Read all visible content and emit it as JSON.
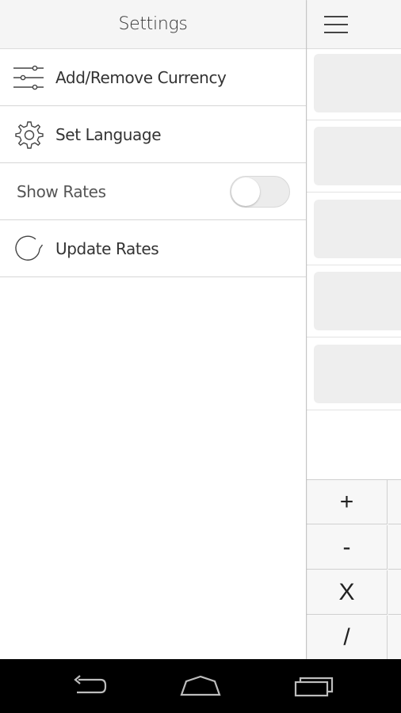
{
  "drawer": {
    "title": "Settings",
    "items": [
      {
        "label": "Add/Remove Currency",
        "icon": "sliders-icon"
      },
      {
        "label": "Set Language",
        "icon": "gear-icon"
      },
      {
        "label": "Show Rates",
        "toggle_on": false
      },
      {
        "label": "Update Rates",
        "icon": "refresh-icon"
      }
    ]
  },
  "main": {
    "menu_icon": "hamburger-menu-icon",
    "keypad": [
      "+",
      "-",
      "X",
      "/"
    ]
  },
  "navbar": {
    "buttons": [
      "back-icon",
      "home-icon",
      "recent-apps-icon"
    ]
  },
  "colors": {
    "header_bg": "#f5f5f5",
    "card_bg": "#eeeeee",
    "navbar_bg": "#000000"
  }
}
